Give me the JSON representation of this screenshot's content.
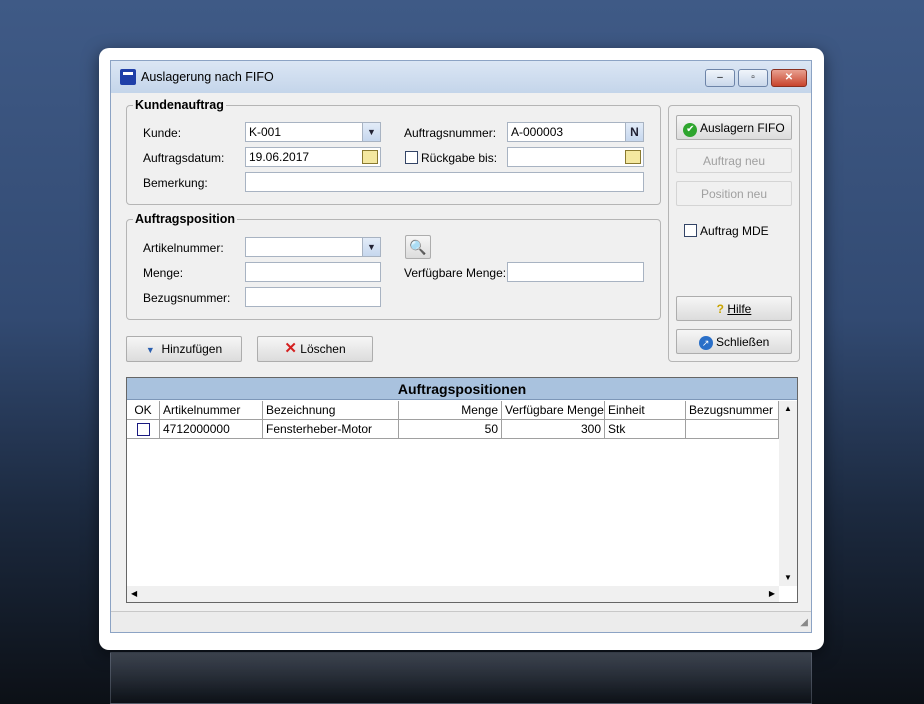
{
  "window": {
    "title": "Auslagerung nach FIFO",
    "minimize": "–",
    "maximize": "▫",
    "close": "✕"
  },
  "kundenauftrag": {
    "legend": "Kundenauftrag",
    "kunde_label": "Kunde:",
    "kunde_value": "K-001",
    "auftragsnummer_label": "Auftragsnummer:",
    "auftragsnummer_value": "A-000003",
    "n_button": "N",
    "auftragsdatum_label": "Auftragsdatum:",
    "auftragsdatum_value": "19.06.2017",
    "rueckgabe_label": "Rückgabe bis:",
    "rueckgabe_value": "",
    "bemerkung_label": "Bemerkung:",
    "bemerkung_value": ""
  },
  "auftragsposition": {
    "legend": "Auftragsposition",
    "artikelnummer_label": "Artikelnummer:",
    "artikelnummer_value": "",
    "menge_label": "Menge:",
    "menge_value": "",
    "verfuegbare_label": "Verfügbare Menge:",
    "verfuegbare_value": "",
    "bezugsnummer_label": "Bezugsnummer:",
    "bezugsnummer_value": ""
  },
  "actions": {
    "hinzufuegen": "Hinzufügen",
    "loeschen": "Löschen"
  },
  "side": {
    "auslagern": "Auslagern FIFO",
    "auftrag_neu": "Auftrag neu",
    "position_neu": "Position neu",
    "auftrag_mde": "Auftrag MDE",
    "hilfe": "Hilfe",
    "schliessen": "Schließen"
  },
  "grid": {
    "title": "Auftragspositionen",
    "columns": [
      "OK",
      "Artikelnummer",
      "Bezeichnung",
      "Menge",
      "Verfügbare Menge",
      "Einheit",
      "Bezugsnummer"
    ],
    "rows": [
      {
        "ok": false,
        "artikelnummer": "4712000000",
        "bezeichnung": "Fensterheber-Motor",
        "menge": "50",
        "verfuegbar": "300",
        "einheit": "Stk",
        "bezugsnummer": ""
      }
    ]
  }
}
